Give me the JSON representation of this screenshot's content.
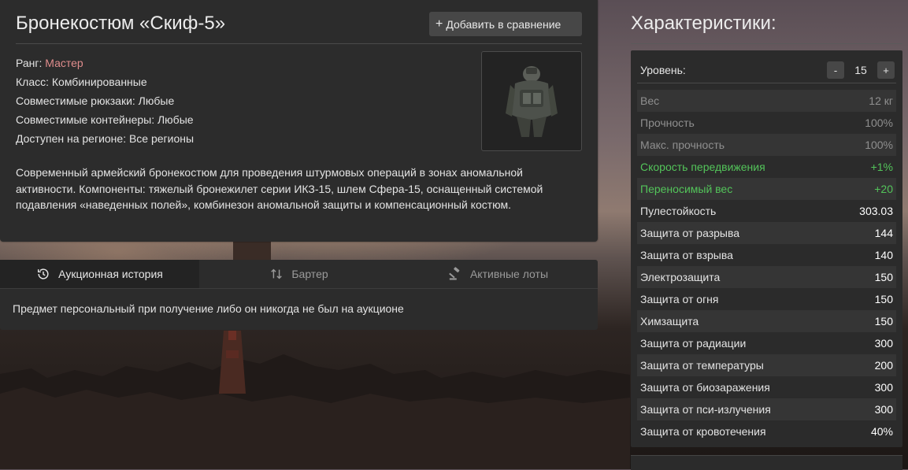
{
  "item": {
    "title": "Бронекостюм «Скиф-5»",
    "compare_button": "Добавить в сравнение",
    "rank_label": "Ранг:",
    "rank_value": "Мастер",
    "class_line": "Класс: Комбинированные",
    "backpacks_line": "Совместимые рюкзаки: Любые",
    "containers_line": "Совместимые контейнеры: Любые",
    "region_line": "Доступен на регионе: Все регионы",
    "description": "Современный армейский бронекостюм для проведения штурмовых операций в зонах аномальной активности. Компоненты: тяжелый бронежилет серии ИКЗ-15, шлем Сфера-15, оснащенный системой подавления «наведенных полей», комбинезон аномальной защиты и компенсационный костюм."
  },
  "tabs": [
    {
      "label": "Аукционная история",
      "icon": "history-icon",
      "active": true
    },
    {
      "label": "Бартер",
      "icon": "swap-arrows-icon",
      "active": false
    },
    {
      "label": "Активные лоты",
      "icon": "auction-hammer-icon",
      "active": false
    }
  ],
  "auction_message": "Предмет персональный при получение либо он никогда не был на аукционе",
  "characteristics": {
    "heading": "Характеристики:",
    "level_label": "Уровень:",
    "level_value": "15",
    "decrement": "-",
    "increment": "+",
    "stats": [
      {
        "name": "Вес",
        "value": "12 кг",
        "style": "muted"
      },
      {
        "name": "Прочность",
        "value": "100%",
        "style": "muted"
      },
      {
        "name": "Макс. прочность",
        "value": "100%",
        "style": "muted"
      },
      {
        "name": "Скорость передвижения",
        "value": "+1%",
        "style": "green"
      },
      {
        "name": "Переносимый вес",
        "value": "+20",
        "style": "green"
      },
      {
        "name": "Пулестойкость",
        "value": "303.03",
        "style": "normal"
      },
      {
        "name": "Защита от разрыва",
        "value": "144",
        "style": "normal"
      },
      {
        "name": "Защита от взрыва",
        "value": "140",
        "style": "normal"
      },
      {
        "name": "Электрозащита",
        "value": "150",
        "style": "normal"
      },
      {
        "name": "Защита от огня",
        "value": "150",
        "style": "normal"
      },
      {
        "name": "Химзащита",
        "value": "150",
        "style": "normal"
      },
      {
        "name": "Защита от радиации",
        "value": "300",
        "style": "normal"
      },
      {
        "name": "Защита от температуры",
        "value": "200",
        "style": "normal"
      },
      {
        "name": "Защита от биозаражения",
        "value": "300",
        "style": "normal"
      },
      {
        "name": "Защита от пси-излучения",
        "value": "300",
        "style": "normal"
      },
      {
        "name": "Защита от кровотечения",
        "value": "40%",
        "style": "normal"
      }
    ]
  },
  "colors": {
    "rank_accent": "#e08d8d",
    "positive_stat": "#53c45a",
    "panel_bg": "#2c2c2c"
  }
}
